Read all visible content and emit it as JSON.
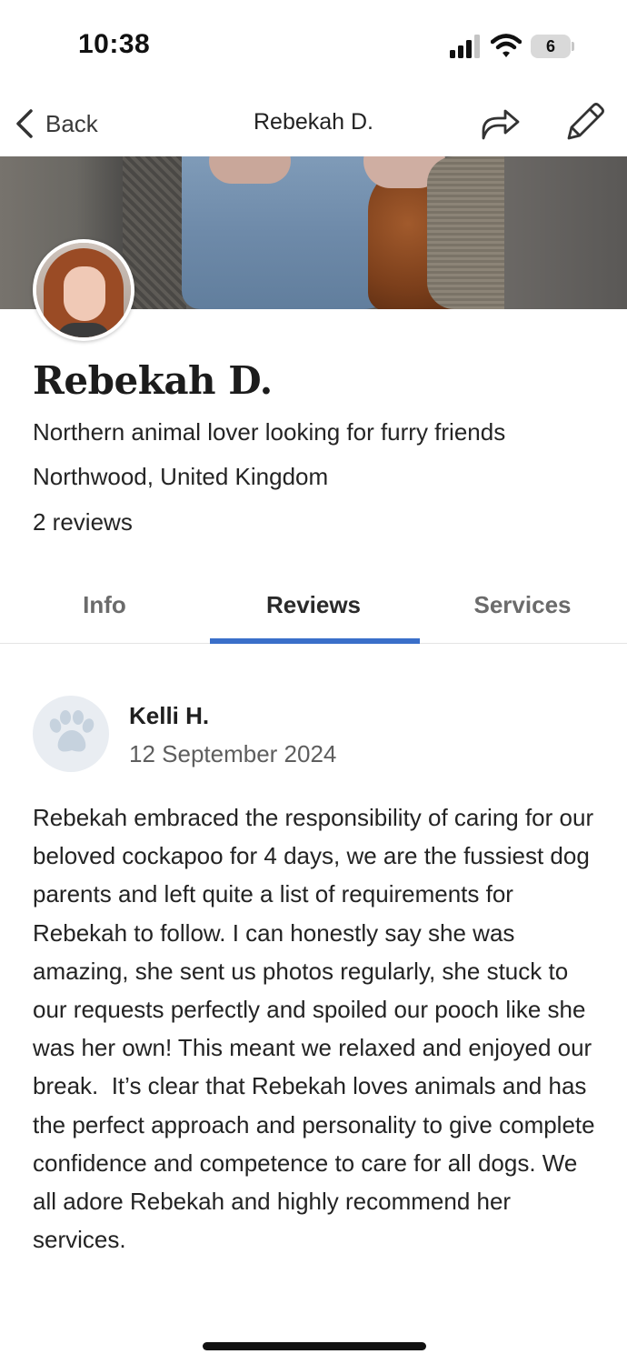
{
  "status_bar": {
    "time": "10:38",
    "battery_level": "6"
  },
  "nav": {
    "back_label": "Back",
    "title": "Rebekah D."
  },
  "profile": {
    "name": "Rebekah D.",
    "tagline": "Northern animal lover looking for furry friends",
    "location": "Northwood, United Kingdom",
    "review_count": "2 reviews"
  },
  "tabs": [
    {
      "label": "Info",
      "active": false
    },
    {
      "label": "Reviews",
      "active": true
    },
    {
      "label": "Services",
      "active": false
    }
  ],
  "review": {
    "reviewer_name": "Kelli H.",
    "date": "12 September 2024",
    "body": "Rebekah embraced the responsibility of caring for our beloved cockapoo for 4 days, we are the fussiest dog parents and left quite a list of requirements for Rebekah to follow. I can honestly say she was amazing, she sent us photos regularly, she stuck to our requests perfectly and spoiled our pooch like she was her own! This meant we relaxed and enjoyed our break.  It’s clear that Rebekah loves animals and has the perfect approach and personality to give complete confidence and competence to care for all dogs. We all adore Rebekah and highly recommend her services."
  },
  "icons": {
    "back": "chevron-left-icon",
    "share": "share-arrow-icon",
    "edit": "pencil-icon",
    "reviewer_avatar": "paw-print-icon"
  },
  "colors": {
    "accent": "#3a6fc9",
    "paw": "#c6d2de"
  }
}
